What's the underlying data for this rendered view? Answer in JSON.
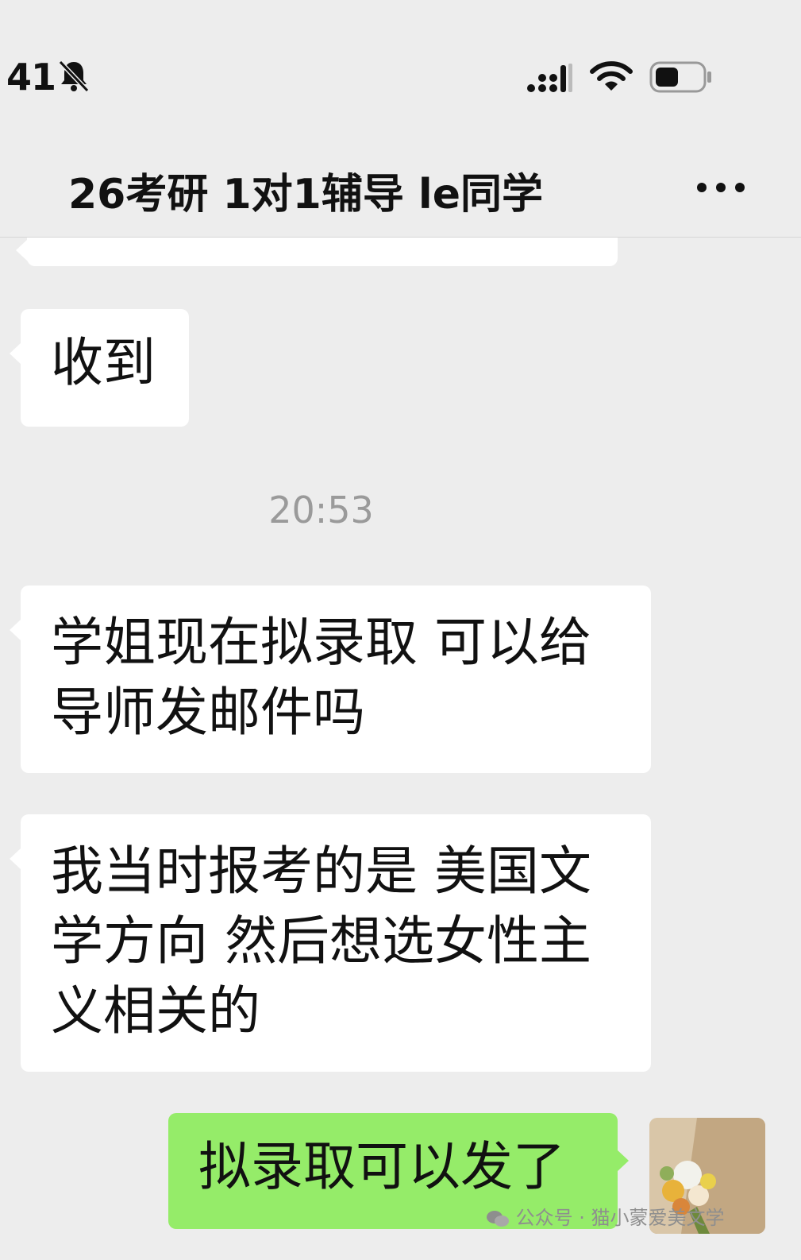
{
  "status_bar": {
    "time": "41",
    "icons": [
      "bell-muted-icon",
      "cellular-signal-icon",
      "wifi-icon",
      "battery-icon"
    ]
  },
  "nav": {
    "title": "26考研 1对1辅导 le同学",
    "more_icon": "more-dots-icon"
  },
  "messages": [
    {
      "side": "left",
      "text": ""
    },
    {
      "side": "left",
      "text": "收到"
    },
    {
      "type": "timestamp",
      "text": "20:53"
    },
    {
      "side": "left",
      "lines": [
        "学姐现在拟录取 可以给",
        "导师发邮件吗"
      ]
    },
    {
      "side": "left",
      "lines": [
        "我当时报考的是 美国文",
        "学方向 然后想选女性主",
        "义相关的"
      ]
    },
    {
      "side": "right",
      "text": "拟录取可以发了"
    }
  ],
  "watermark": {
    "text": "公众号 · 猫小蒙爱美文学",
    "icon": "wechat-icon"
  },
  "colors": {
    "background": "#ededed",
    "incoming_bubble": "#ffffff",
    "outgoing_bubble": "#95ec69",
    "timestamp_text": "#9a9a9a"
  }
}
